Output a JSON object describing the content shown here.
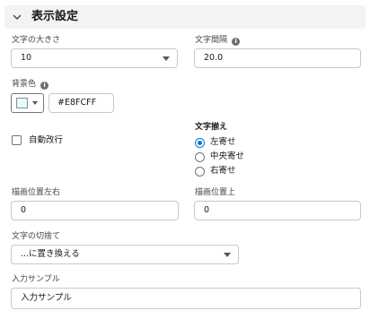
{
  "section": {
    "title": "表示設定",
    "icon": "chevron-down-icon"
  },
  "font_size": {
    "label": "文字の大きさ",
    "value": "10"
  },
  "letter_spacing": {
    "label": "文字間隔",
    "value": "20.0"
  },
  "background_color": {
    "label": "背景色",
    "value": "#E8FCFF",
    "swatch_color": "#E8FCFF"
  },
  "word_wrap": {
    "label": "自動改行",
    "checked": false
  },
  "alignment": {
    "label": "文字揃え",
    "options": [
      "左寄せ",
      "中央寄せ",
      "右寄せ"
    ],
    "selected": "左寄せ"
  },
  "draw_left": {
    "label": "描画位置左右",
    "value": "0"
  },
  "draw_top": {
    "label": "描画位置上",
    "value": "0"
  },
  "truncation": {
    "label": "文字の切捨て",
    "value": "...に置き換える"
  },
  "input_sample": {
    "label": "入力サンプル",
    "value": "入力サンプル"
  },
  "colors": {
    "accent": "#0176d3",
    "border": "#c9c9c9",
    "header_bg": "#f3f3f3"
  }
}
